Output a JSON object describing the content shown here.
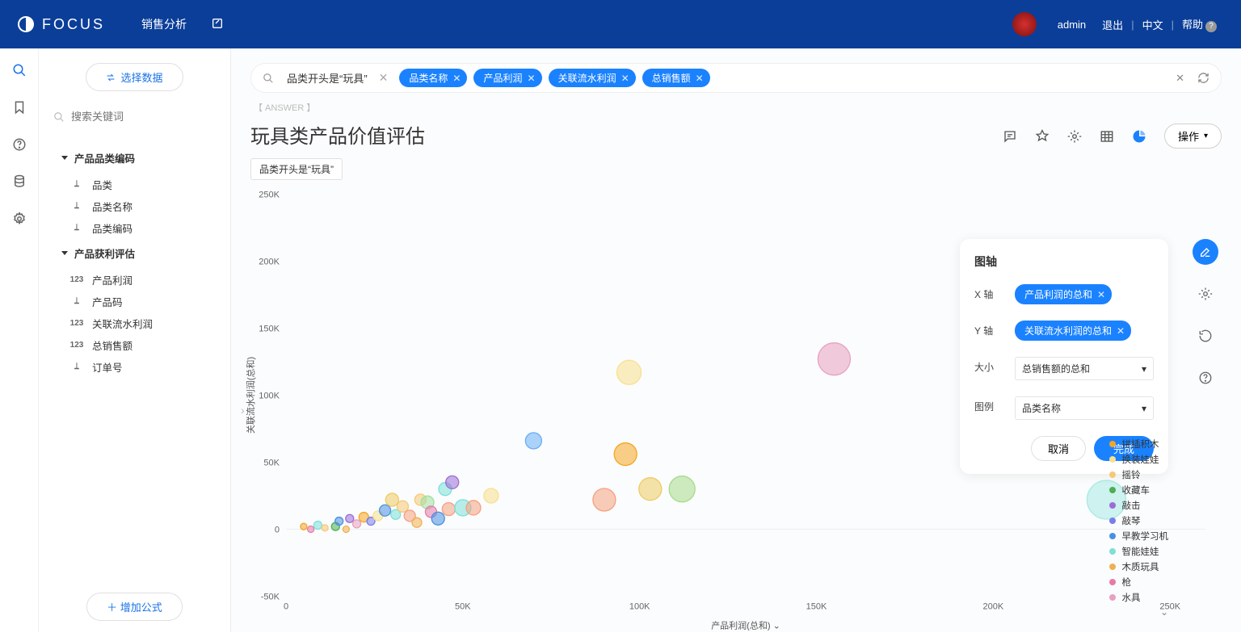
{
  "header": {
    "brand": "FOCUS",
    "nav": "销售分析",
    "user": "admin",
    "logout": "退出",
    "lang": "中文",
    "help": "帮助"
  },
  "sidebar": {
    "select_data": "选择数据",
    "search_placeholder": "搜索关键词",
    "groups": [
      {
        "title": "产品品类编码",
        "fields": [
          {
            "icon": "T",
            "label": "品类"
          },
          {
            "icon": "T",
            "label": "品类名称"
          },
          {
            "icon": "T",
            "label": "品类编码"
          }
        ]
      },
      {
        "title": "产品获利评估",
        "fields": [
          {
            "icon": "123",
            "label": "产品利润"
          },
          {
            "icon": "T",
            "label": "产品码"
          },
          {
            "icon": "123",
            "label": "关联流水利润"
          },
          {
            "icon": "123",
            "label": "总销售额"
          },
          {
            "icon": "T",
            "label": "订单号"
          }
        ]
      }
    ],
    "add_formula": "增加公式"
  },
  "query": {
    "text": "品类开头是“玩具”",
    "chips": [
      "品类名称",
      "产品利润",
      "关联流水利润",
      "总销售额"
    ]
  },
  "answer_label": "【 ANSWER 】",
  "title": "玩具类产品价值评估",
  "op_label": "操作",
  "filter_tag": "品类开头是“玩具”",
  "config": {
    "title": "图轴",
    "x_label": "X 轴",
    "x_pill": "产品利润的总和",
    "y_label": "Y 轴",
    "y_pill": "关联流水利润的总和",
    "size_label": "大小",
    "size_val": "总销售额的总和",
    "legend_label": "图例",
    "legend_val": "品类名称",
    "cancel": "取消",
    "done": "完成"
  },
  "legend_items": [
    {
      "label": "拼插积木",
      "color": "#f5a623"
    },
    {
      "label": "换装娃娃",
      "color": "#f8e08e"
    },
    {
      "label": "摇铃",
      "color": "#f7c875"
    },
    {
      "label": "收藏车",
      "color": "#4caf50"
    },
    {
      "label": "敲击",
      "color": "#9b6dd7"
    },
    {
      "label": "敲琴",
      "color": "#7a7de8"
    },
    {
      "label": "早教学习机",
      "color": "#4a90e2"
    },
    {
      "label": "智能娃娃",
      "color": "#7de0d8"
    },
    {
      "label": "木质玩具",
      "color": "#f0b050"
    },
    {
      "label": "枪",
      "color": "#e87aa8"
    },
    {
      "label": "水具",
      "color": "#e8a0c0"
    }
  ],
  "chart_data": {
    "type": "scatter",
    "xlabel": "产品利润(总和)",
    "ylabel": "关联流水利润(总和)",
    "xlim": [
      0,
      260000
    ],
    "ylim": [
      -50000,
      250000
    ],
    "xticks": [
      0,
      50000,
      100000,
      150000,
      200000,
      250000
    ],
    "yticks": [
      -50000,
      0,
      50000,
      100000,
      150000,
      200000,
      250000
    ],
    "points": [
      {
        "x": 5000,
        "y": 2000,
        "r": 4,
        "c": "#f5a623"
      },
      {
        "x": 7000,
        "y": 0,
        "r": 4,
        "c": "#e87aa8"
      },
      {
        "x": 9000,
        "y": 3000,
        "r": 5,
        "c": "#7de0d8"
      },
      {
        "x": 11000,
        "y": 1000,
        "r": 4,
        "c": "#f7c875"
      },
      {
        "x": 14000,
        "y": 2000,
        "r": 5,
        "c": "#4caf50"
      },
      {
        "x": 15000,
        "y": 6000,
        "r": 5,
        "c": "#4a90e2"
      },
      {
        "x": 17000,
        "y": 0,
        "r": 4,
        "c": "#f0b050"
      },
      {
        "x": 18000,
        "y": 8000,
        "r": 5,
        "c": "#9b6dd7"
      },
      {
        "x": 20000,
        "y": 4000,
        "r": 5,
        "c": "#e8a0c0"
      },
      {
        "x": 22000,
        "y": 9000,
        "r": 6,
        "c": "#f5a623"
      },
      {
        "x": 24000,
        "y": 6000,
        "r": 5,
        "c": "#7a7de8"
      },
      {
        "x": 26000,
        "y": 10000,
        "r": 6,
        "c": "#f8e08e"
      },
      {
        "x": 28000,
        "y": 14000,
        "r": 7,
        "c": "#4a90e2"
      },
      {
        "x": 30000,
        "y": 22000,
        "r": 8,
        "c": "#eecb60"
      },
      {
        "x": 31000,
        "y": 11000,
        "r": 6,
        "c": "#7de0d8"
      },
      {
        "x": 33000,
        "y": 17000,
        "r": 7,
        "c": "#f7c875"
      },
      {
        "x": 35000,
        "y": 10000,
        "r": 7,
        "c": "#f5a080"
      },
      {
        "x": 37000,
        "y": 5000,
        "r": 6,
        "c": "#f0b050"
      },
      {
        "x": 38000,
        "y": 22000,
        "r": 7,
        "c": "#f7c875"
      },
      {
        "x": 40000,
        "y": 20000,
        "r": 8,
        "c": "#a0e0a0"
      },
      {
        "x": 41000,
        "y": 13000,
        "r": 7,
        "c": "#e87aa8"
      },
      {
        "x": 43000,
        "y": 8000,
        "r": 8,
        "c": "#4a90e2"
      },
      {
        "x": 45000,
        "y": 30000,
        "r": 8,
        "c": "#7de0d8"
      },
      {
        "x": 46000,
        "y": 15000,
        "r": 8,
        "c": "#f5a080"
      },
      {
        "x": 47000,
        "y": 35000,
        "r": 8,
        "c": "#9b6dd7"
      },
      {
        "x": 50000,
        "y": 16000,
        "r": 10,
        "c": "#7de0d8"
      },
      {
        "x": 53000,
        "y": 16000,
        "r": 9,
        "c": "#f5a080"
      },
      {
        "x": 58000,
        "y": 25000,
        "r": 9,
        "c": "#f8e08e"
      },
      {
        "x": 70000,
        "y": 66000,
        "r": 10,
        "c": "#6aaef5"
      },
      {
        "x": 90000,
        "y": 22000,
        "r": 14,
        "c": "#f5a080"
      },
      {
        "x": 96000,
        "y": 56000,
        "r": 14,
        "c": "#f5a623"
      },
      {
        "x": 97000,
        "y": 117000,
        "r": 15,
        "c": "#f8e08e"
      },
      {
        "x": 103000,
        "y": 30000,
        "r": 14,
        "c": "#eecb60"
      },
      {
        "x": 112000,
        "y": 30000,
        "r": 16,
        "c": "#a8db8a"
      },
      {
        "x": 155000,
        "y": 127000,
        "r": 20,
        "c": "#e8a0c0"
      },
      {
        "x": 232000,
        "y": 22000,
        "r": 24,
        "c": "#a8eae4"
      }
    ]
  }
}
